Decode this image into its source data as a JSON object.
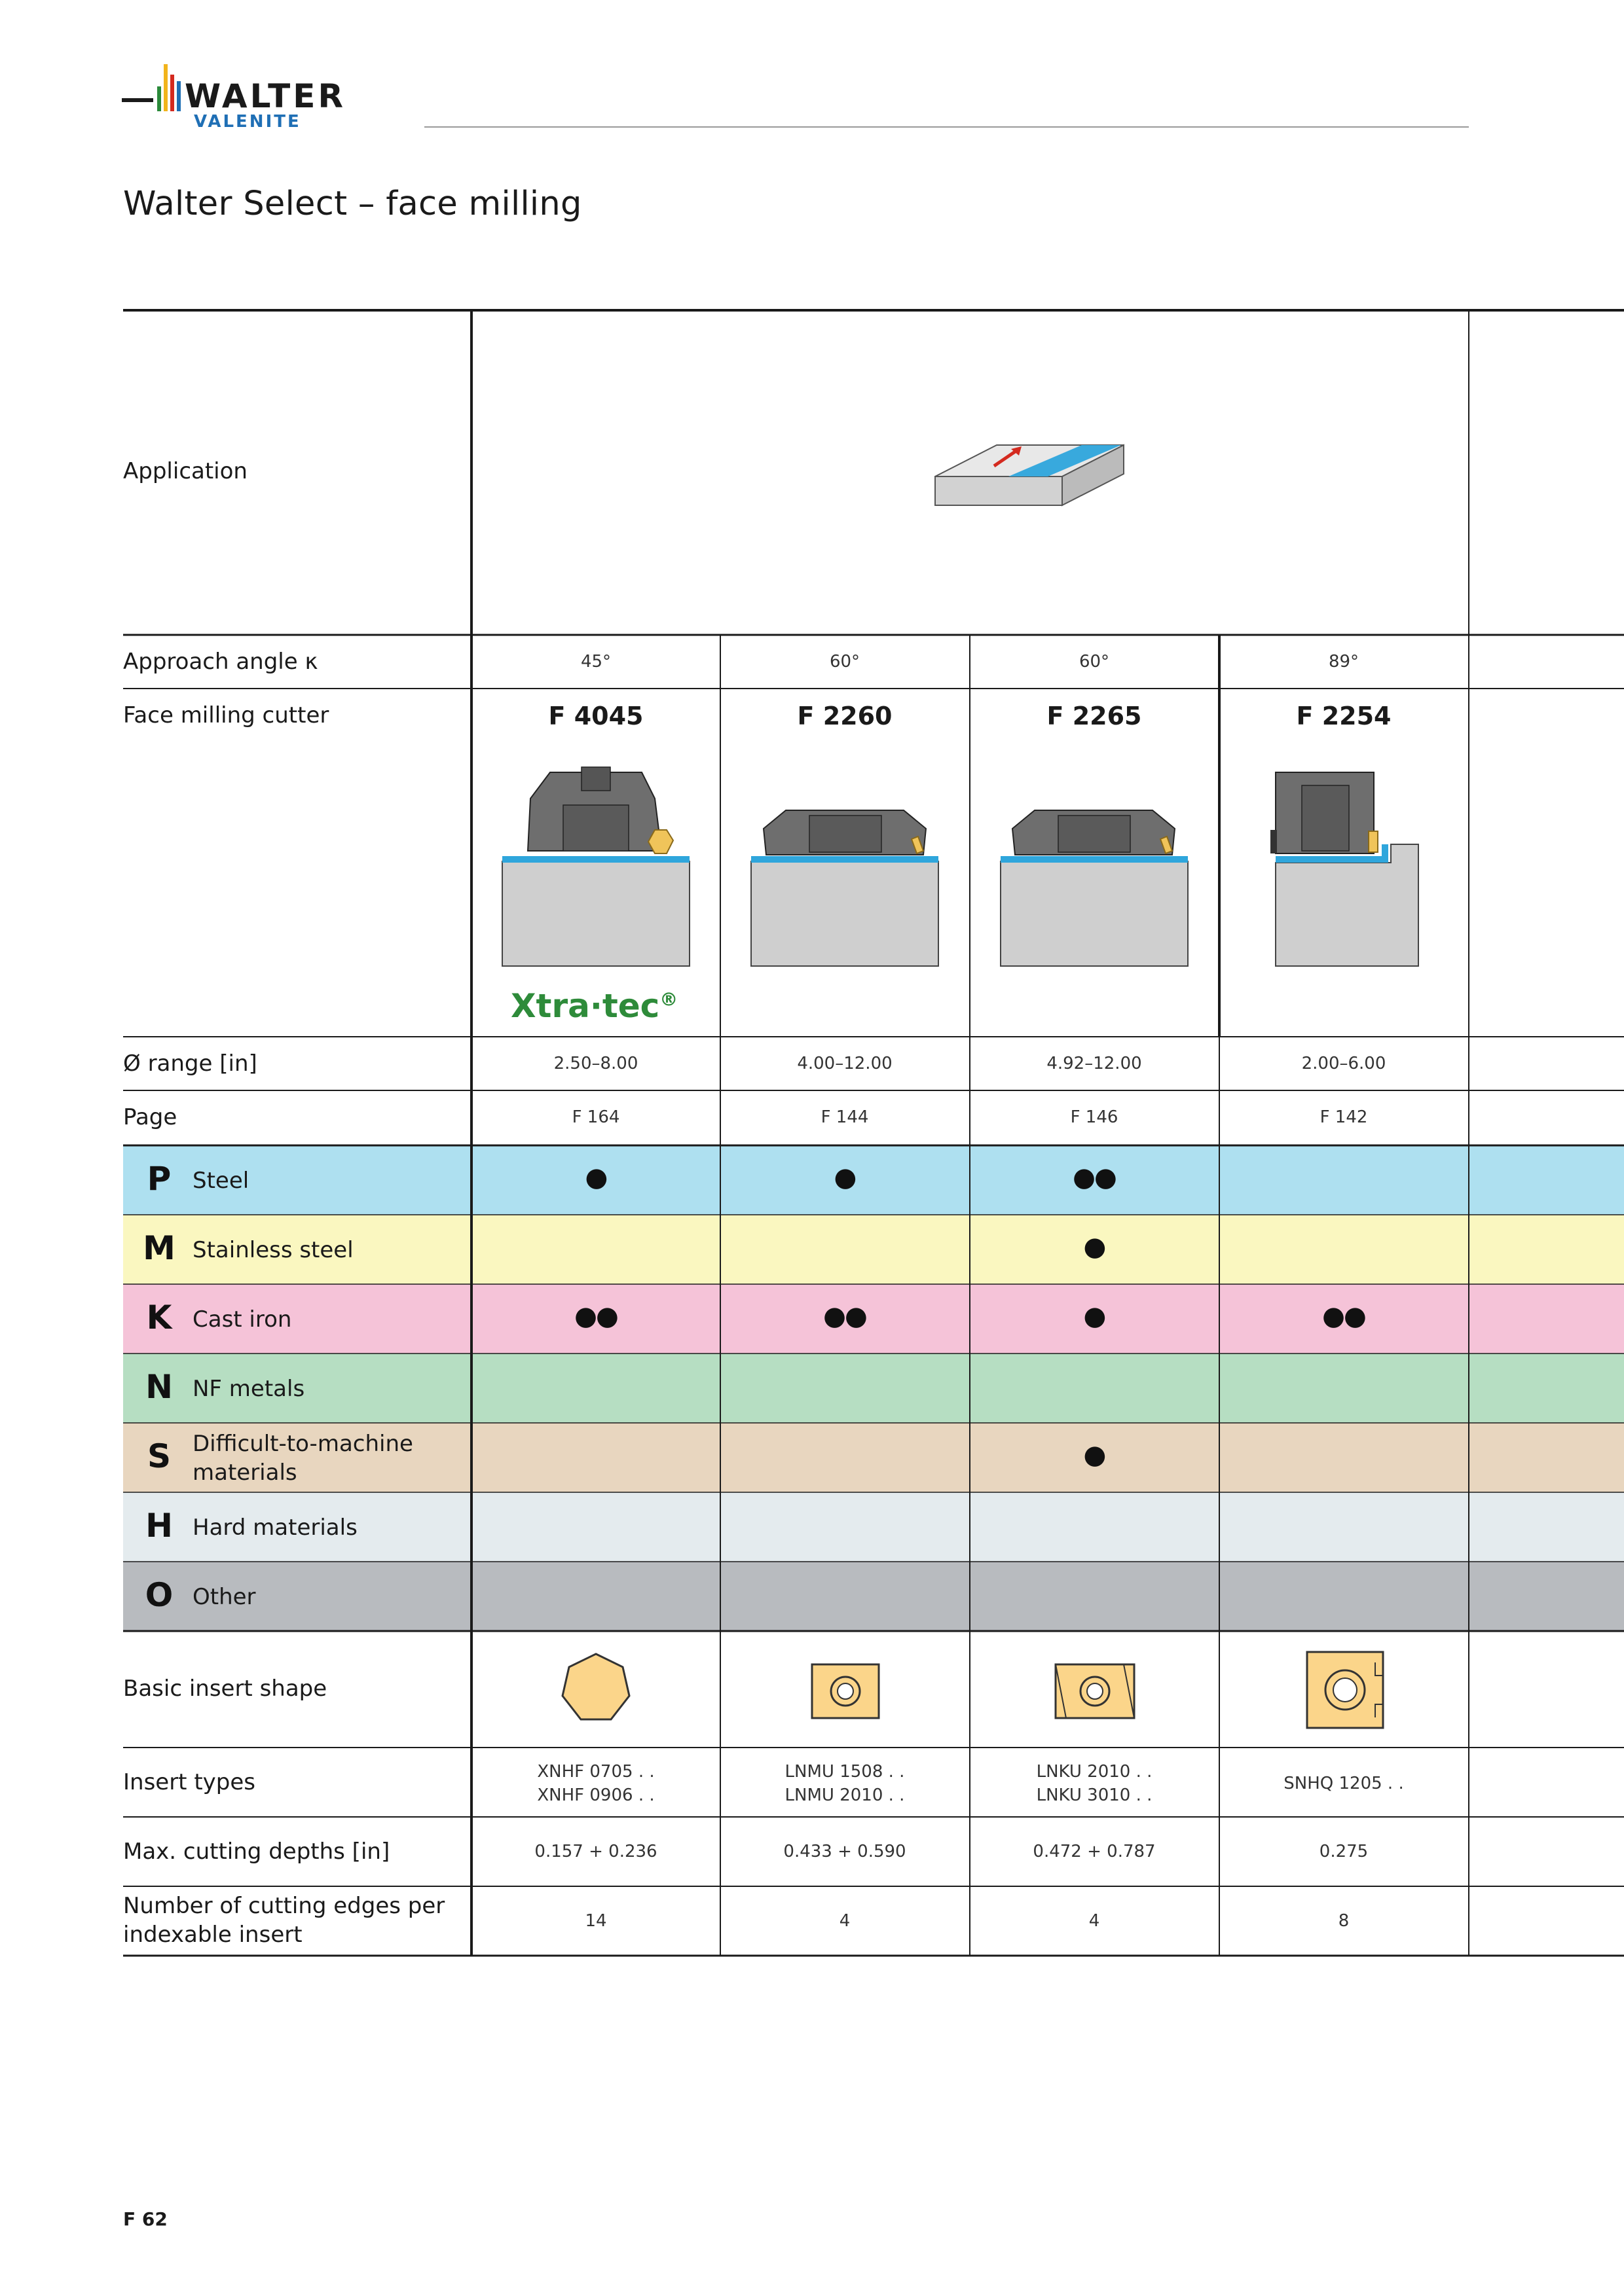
{
  "brand": {
    "line1": "WALTER",
    "line2": "VALENITE"
  },
  "page_title": "Walter Select – face milling",
  "page_number": "F 62",
  "row_labels": {
    "application": "Application",
    "approach_angle": "Approach angle κ",
    "cutter": "Face milling cutter",
    "range": "Ø range [in]",
    "page": "Page",
    "insert_shape": "Basic insert shape",
    "insert_types": "Insert types",
    "max_depth": "Max. cutting depths [in]",
    "edges_1": "Number of cutting edges per",
    "edges_2": "indexable insert"
  },
  "columns": [
    {
      "angle": "45°",
      "cutter": "F 4045",
      "range": "2.50–8.00",
      "page": "F 164",
      "insert1": "XNHF 0705 . .",
      "insert2": "XNHF 0906 . .",
      "depth": "0.157 + 0.236",
      "edges": "14"
    },
    {
      "angle": "60°",
      "cutter": "F 2260",
      "range": "4.00–12.00",
      "page": "F 144",
      "insert1": "LNMU 1508 . .",
      "insert2": "LNMU 2010 . .",
      "depth": "0.433 + 0.590",
      "edges": "4"
    },
    {
      "angle": "60°",
      "cutter": "F 2265",
      "range": "4.92–12.00",
      "page": "F 146",
      "insert1": "LNKU 2010 . .",
      "insert2": "LNKU 3010 . .",
      "depth": "0.472 + 0.787",
      "edges": "4"
    },
    {
      "angle": "89°",
      "cutter": "F 2254",
      "range": "2.00–6.00",
      "page": "F 142",
      "insert1": "SNHQ 1205 . .",
      "insert2": "",
      "depth": "0.275",
      "edges": "8"
    }
  ],
  "xtratec": {
    "text": "Xtra·tec",
    "mark": "®"
  },
  "materials": [
    {
      "letter": "P",
      "name": "Steel",
      "color": "#aee0f0",
      "marks": [
        "●",
        "●",
        "●●",
        ""
      ]
    },
    {
      "letter": "M",
      "name": "Stainless steel",
      "color": "#faf7c0",
      "marks": [
        "",
        "",
        "●",
        ""
      ]
    },
    {
      "letter": "K",
      "name": "Cast iron",
      "color": "#f5c3d8",
      "marks": [
        "●●",
        "●●",
        "●",
        "●●"
      ]
    },
    {
      "letter": "N",
      "name": "NF metals",
      "color": "#b6dec2",
      "marks": [
        "",
        "",
        "",
        ""
      ]
    },
    {
      "letter": "S",
      "name1": "Difficult-to-machine",
      "name2": "materials",
      "color": "#e8d6bf",
      "marks": [
        "",
        "",
        "●",
        ""
      ]
    },
    {
      "letter": "H",
      "name": "Hard materials",
      "color": "#e4ebee",
      "marks": [
        "",
        "",
        "",
        ""
      ]
    },
    {
      "letter": "O",
      "name": "Other",
      "color": "#b8bbbf",
      "marks": [
        "",
        "",
        "",
        ""
      ]
    }
  ]
}
